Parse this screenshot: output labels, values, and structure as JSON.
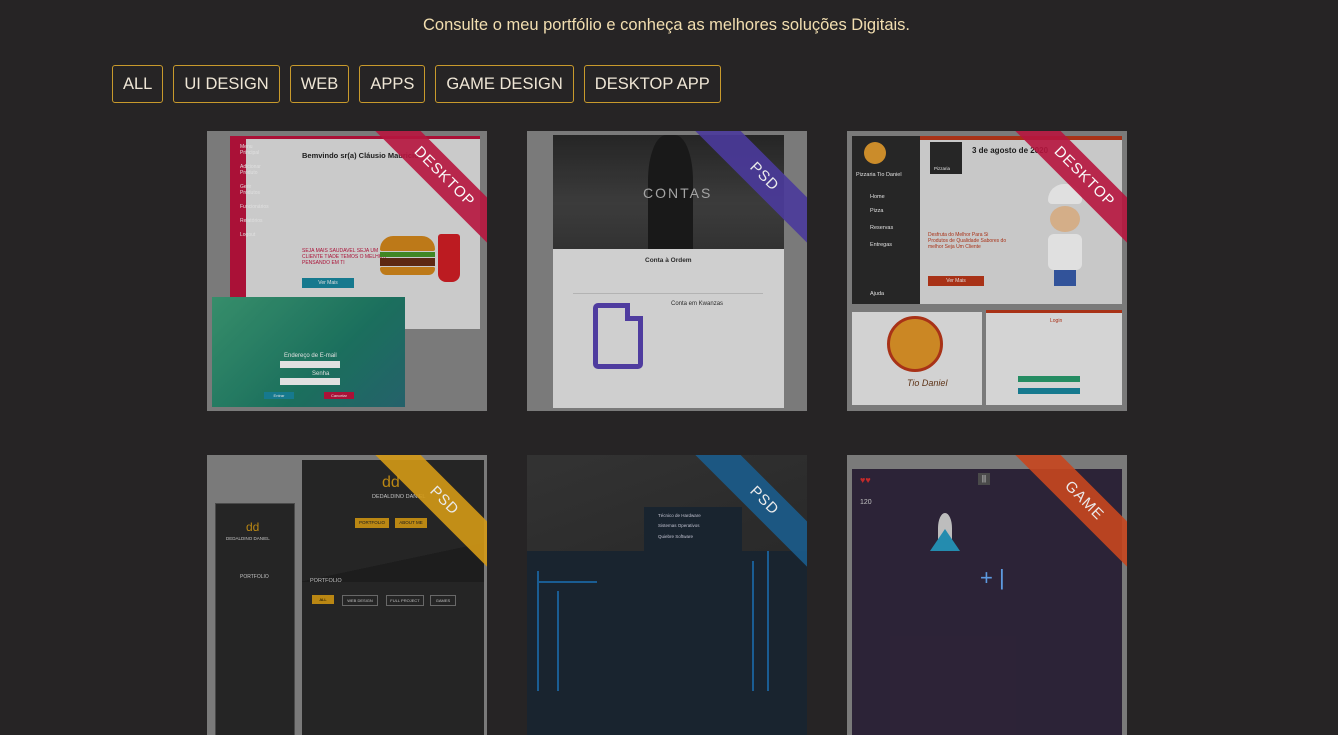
{
  "header": {
    "subtitle": "Consulte o meu portfólio e conheça as melhores soluções Digitais."
  },
  "filters": [
    "ALL",
    "UI DESIGN",
    "WEB",
    "APPS",
    "GAME DESIGN",
    "DESKTOP APP"
  ],
  "cards": [
    {
      "badge": "DESKTOP",
      "badge_color": "#b7163f",
      "welcome": "Bemvindo sr(a) Cláusio Mauricio",
      "menu": [
        "Menu Principal",
        "Adicionar Produto",
        "Gerir Produtos",
        "Funcionários",
        "Relatórios",
        "Logout"
      ],
      "promo": "SEJA MAIS SAUDAVEL SEJA UM CLIENTE TIADE TEMOS O MELHOR PENSANDO EM TI",
      "cta": "Ver Mais",
      "login_email": "Endereço de E-mail",
      "login_pass": "Senha",
      "btn_enter": "Entrar",
      "btn_cancel": "Cancelar"
    },
    {
      "badge": "PSD",
      "badge_color": "#4b3a9c",
      "hero": "CONTAS",
      "section": "Conta à Ordem",
      "item": "Conta em Kwanzas"
    },
    {
      "badge": "DESKTOP",
      "badge_color": "#b7163f",
      "date": "3 de agosto de 2020",
      "brand": "Pizzaria Tio Daniel",
      "logo_label": "Pizzaria",
      "menu": [
        "Home",
        "Pizza",
        "Reservas",
        "Entregas"
      ],
      "help": "Ajuda",
      "promo": "Desfruta do Melhor Para Si Produtos de Qualidade Sabores do melhor Seja Um Cliente",
      "cta": "Ver Mais",
      "logo_title": "Tio Daniel",
      "login_title": "Login"
    },
    {
      "badge": "PSD",
      "badge_color": "#d49a16",
      "brand": "DEDALDINO DANIEL",
      "btn1": "PORTFOLIO",
      "btn2": "ABOUT ME",
      "section": "PORTFOLIO",
      "tabs": [
        "ALL",
        "WEB DESIGN",
        "FULL PROJECT",
        "GAMES"
      ]
    },
    {
      "badge": "PSD",
      "badge_color": "#1b5c8c",
      "items": [
        "Técnico de Hardware",
        "Sistemas Operativos",
        "Quiebre Software"
      ]
    },
    {
      "badge": "GAME",
      "badge_color": "#c8471f",
      "score": "120"
    }
  ],
  "colors": {
    "accent": "#c89a2c",
    "text": "#f2deb0",
    "background": "#262425"
  }
}
